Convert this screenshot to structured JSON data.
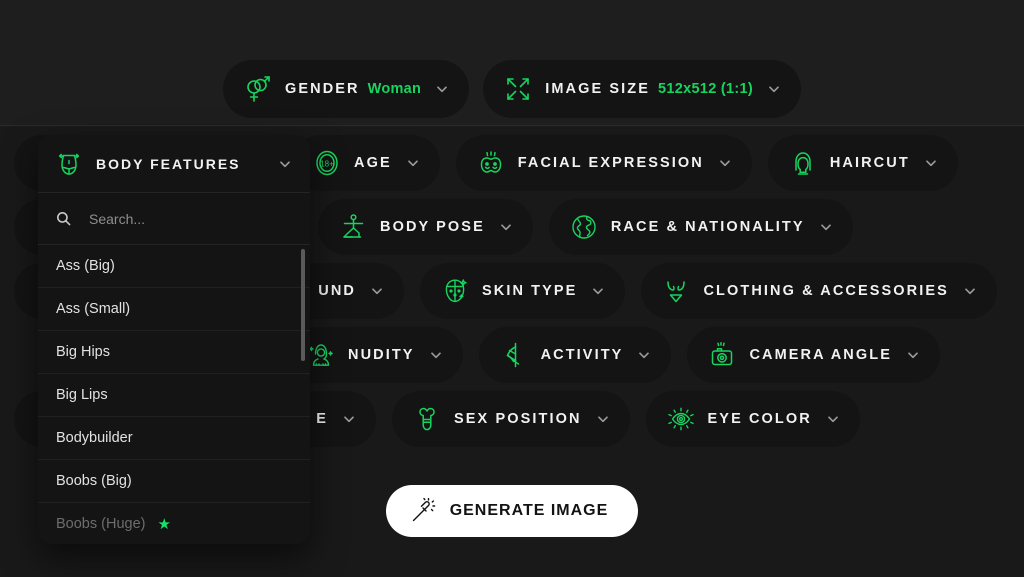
{
  "top_bar": {
    "chips": [
      {
        "icon": "gender-symbols-icon",
        "label": "GENDER",
        "value": "Woman",
        "caret": "chevron-down-icon"
      },
      {
        "icon": "resize-arrows-icon",
        "label": "IMAGE SIZE",
        "value": "512x512 (1:1)",
        "caret": "chevron-down-icon"
      }
    ]
  },
  "option_rows": [
    {
      "chips": [
        {
          "icon": "body-features-icon",
          "label": "BODY FEATURES",
          "hidden_behind_panel": true
        },
        {
          "icon": "age-18-plus-icon",
          "label": "AGE"
        },
        {
          "icon": "facial-expression-icon",
          "label": "FACIAL EXPRESSION"
        },
        {
          "icon": "haircut-icon",
          "label": "HAIRCUT"
        }
      ]
    },
    {
      "chips": [
        {
          "icon": "hidden-icon",
          "label": "",
          "hidden_behind_panel": true
        },
        {
          "icon": "body-pose-icon",
          "label": "BODY POSE"
        },
        {
          "icon": "globe-icon",
          "label": "RACE & NATIONALITY"
        }
      ]
    },
    {
      "chips": [
        {
          "icon": "background-icon",
          "label": "UND",
          "hidden_behind_panel": true
        },
        {
          "icon": "skin-type-icon",
          "label": "SKIN TYPE"
        },
        {
          "icon": "clothing-icon",
          "label": "CLOTHING & ACCESSORIES"
        }
      ]
    },
    {
      "chips": [
        {
          "icon": "nudity-icon",
          "label": "NUDITY"
        },
        {
          "icon": "activity-icon",
          "label": "ACTIVITY"
        },
        {
          "icon": "camera-angle-icon",
          "label": "CAMERA ANGLE"
        }
      ]
    },
    {
      "chips": [
        {
          "icon": "hidden-icon",
          "label": "E",
          "hidden_behind_panel": true
        },
        {
          "icon": "sex-position-icon",
          "label": "SEX POSITION"
        },
        {
          "icon": "eye-color-icon",
          "label": "EYE COLOR"
        }
      ]
    }
  ],
  "dropdown": {
    "icon": "body-features-icon",
    "title": "BODY FEATURES",
    "caret": "chevron-down-icon",
    "search": {
      "icon": "search-icon",
      "placeholder": "Search...",
      "value": ""
    },
    "items": [
      {
        "label": "Ass (Big)",
        "locked": false,
        "star": ""
      },
      {
        "label": "Ass (Small)",
        "locked": false,
        "star": ""
      },
      {
        "label": "Big Hips",
        "locked": false,
        "star": ""
      },
      {
        "label": "Big Lips",
        "locked": false,
        "star": ""
      },
      {
        "label": "Bodybuilder",
        "locked": false,
        "star": ""
      },
      {
        "label": "Boobs (Big)",
        "locked": false,
        "star": ""
      },
      {
        "label": "Boobs (Huge)",
        "locked": true,
        "star": "★"
      }
    ]
  },
  "generate": {
    "icon": "magic-wand-icon",
    "label": "GENERATE IMAGE"
  },
  "colors": {
    "accent_green": "#17d45f",
    "star_green": "#17e26a",
    "page_background": "#191919",
    "top_band_background": "#1e1e1e",
    "chip_background": "#141414",
    "panel_background": "#141414",
    "generate_button_background": "#ffffff"
  }
}
